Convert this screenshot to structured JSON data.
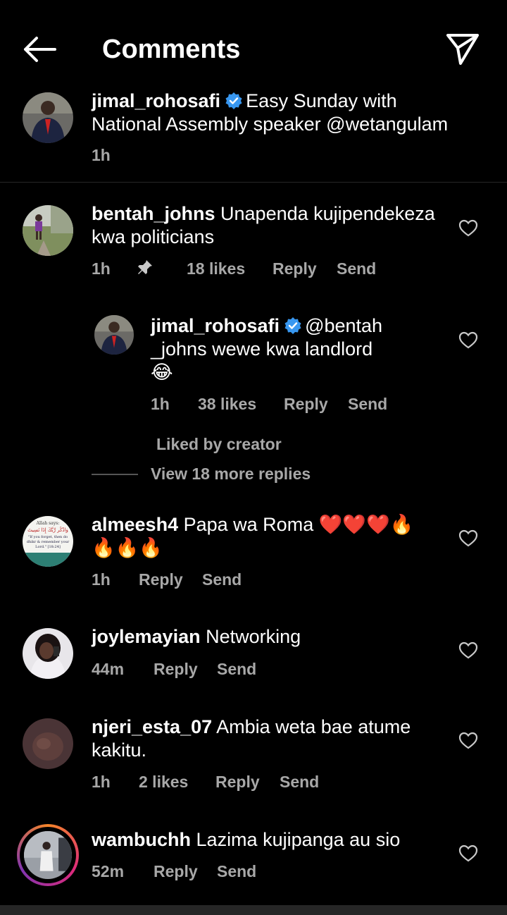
{
  "header": {
    "title": "Comments"
  },
  "post": {
    "username": "jimal_rohosafi",
    "text_line1": "Easy Sunday with",
    "text_line2": "National Assembly speaker @wetangulam",
    "time": "1h"
  },
  "comments": [
    {
      "username": "bentah_johns",
      "text_line1": "Unapenda kujipendekeza",
      "text_line2": "kwa politicians",
      "time": "1h",
      "likes": "18 likes",
      "reply": "Reply",
      "send": "Send",
      "pinned": true
    },
    {
      "username": "almeesh4",
      "text_line1": "Papa wa Roma ❤️❤️❤️🔥",
      "text_line2": "🔥🔥🔥",
      "time": "1h",
      "reply": "Reply",
      "send": "Send",
      "avatar_text": {
        "l1": "Allah says:",
        "l2": "وَاذْكُر رَّبَّكَ إِذَا نَسِيتَ",
        "l3": "\"If you forget, then do",
        "l4": "dhikr & remember your",
        "l5": "Lord.\" [18:24]"
      }
    },
    {
      "username": "joylemayian",
      "text_line1": "Networking",
      "time": "44m",
      "reply": "Reply",
      "send": "Send"
    },
    {
      "username": "njeri_esta_07",
      "text_line1": "Ambia weta bae atume",
      "text_line2": "kakitu.",
      "time": "1h",
      "likes": "2 likes",
      "reply": "Reply",
      "send": "Send"
    },
    {
      "username": "wambuchh",
      "text_line1": "Lazima kujipanga au sio",
      "time": "52m",
      "reply": "Reply",
      "send": "Send"
    }
  ],
  "reply": {
    "username": "jimal_rohosafi",
    "text_line1": "@bentah",
    "text_line2": "_johns wewe kwa landlord",
    "text_line3": "😂",
    "time": "1h",
    "likes": "38 likes",
    "reply": "Reply",
    "send": "Send"
  },
  "liked_by_creator": "Liked by creator",
  "view_more": "View 18 more replies",
  "colors": {
    "verified": "#3897f0",
    "meta": "#a8a8a8",
    "background": "#000000"
  }
}
